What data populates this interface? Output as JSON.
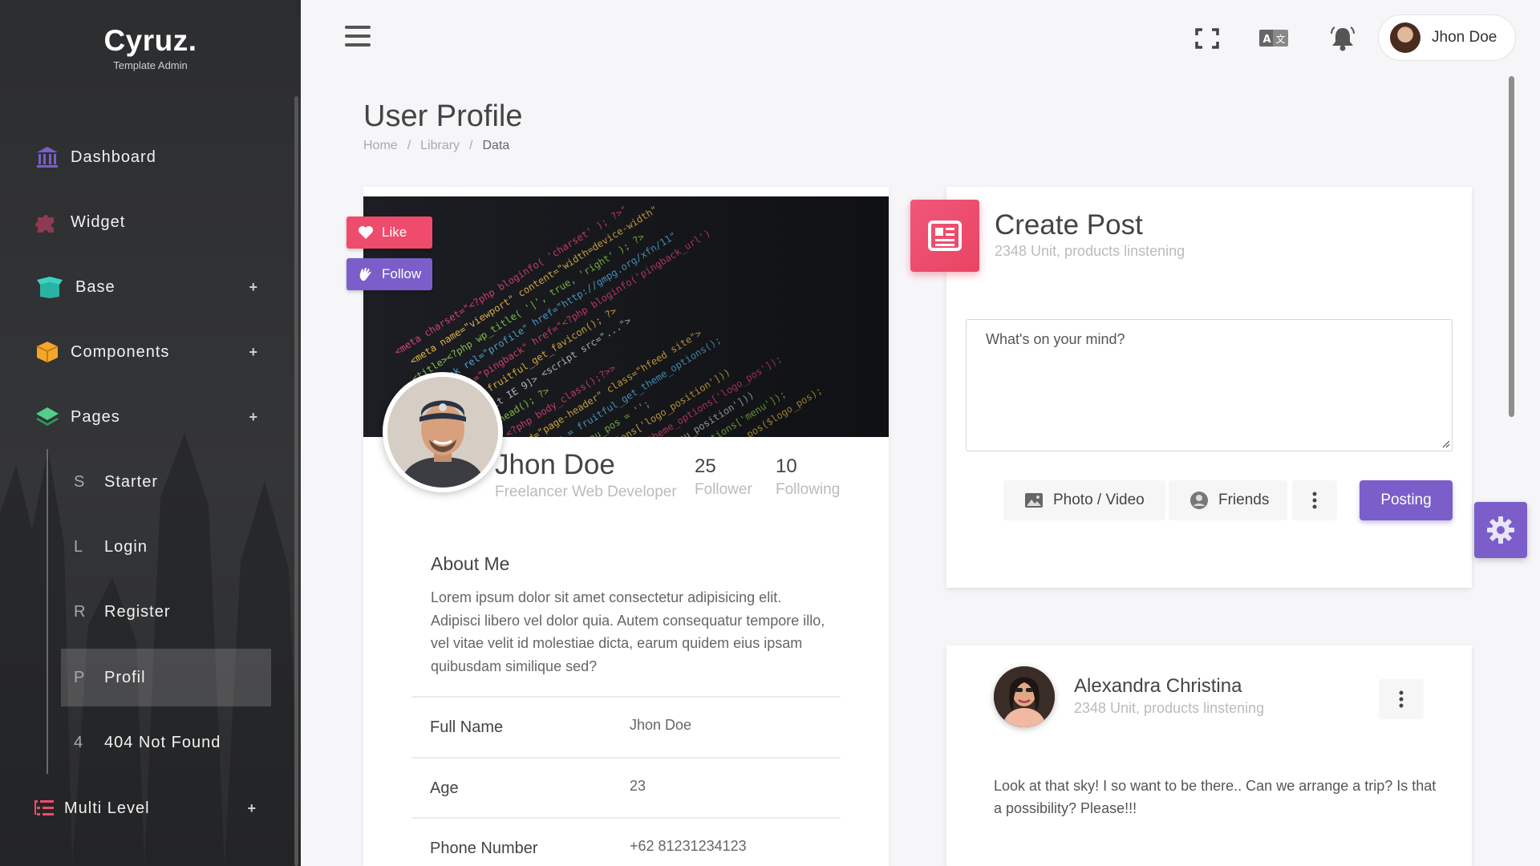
{
  "brand": {
    "name": "Cyruz.",
    "subtitle": "Template Admin"
  },
  "sidebar": {
    "items": [
      {
        "label": "Dashboard",
        "icon": "bank-icon",
        "color": "#7b5ec9"
      },
      {
        "label": "Widget",
        "icon": "puzzle-icon",
        "color": "#8e3a52"
      },
      {
        "label": "Base",
        "icon": "box-open-icon",
        "color": "#2ec4b6",
        "expandable": "+"
      },
      {
        "label": "Components",
        "icon": "cube-icon",
        "color": "#f4a62a",
        "expandable": "+"
      },
      {
        "label": "Pages",
        "icon": "layers-icon",
        "color": "#3bb273",
        "expandable": "+"
      },
      {
        "label": "Multi Level",
        "icon": "list-icon",
        "color": "#ef4b6c",
        "expandable": "+"
      }
    ],
    "pages_submenu": [
      {
        "letter": "S",
        "label": "Starter"
      },
      {
        "letter": "L",
        "label": "Login"
      },
      {
        "letter": "R",
        "label": "Register"
      },
      {
        "letter": "P",
        "label": "Profil",
        "active": true
      },
      {
        "letter": "4",
        "label": "404 Not Found"
      }
    ]
  },
  "topbar": {
    "icons": [
      "menu-icon",
      "fullscreen-icon",
      "translate-icon",
      "bell-icon"
    ],
    "user_name": "Jhon Doe"
  },
  "page": {
    "title": "User Profile",
    "breadcrumb": [
      "Home",
      "/",
      "Library",
      "/",
      "Data"
    ]
  },
  "profile": {
    "like_label": "Like",
    "follow_label": "Follow",
    "name": "Jhon Doe",
    "role": "Freelancer Web Developer",
    "followers": {
      "value": "25",
      "label": "Follower"
    },
    "following": {
      "value": "10",
      "label": "Following"
    },
    "about_title": "About Me",
    "about_text": "Lorem ipsum dolor sit amet consectetur adipisicing elit. Adipisci libero vel dolor quia. Autem consequatur tempore illo, vel vitae velit id molestiae dicta, earum quidem eius ipsam quibusdam similique sed?",
    "info": [
      {
        "key": "Full Name",
        "value": "Jhon Doe"
      },
      {
        "key": "Age",
        "value": "23"
      },
      {
        "key": "Phone Number",
        "value": "+62 81231234123"
      }
    ]
  },
  "create_post": {
    "title": "Create Post",
    "subtitle": "2348 Unit, products linstening",
    "placeholder": "What's on your mind?",
    "photo_label": "Photo / Video",
    "friends_label": "Friends",
    "submit_label": "Posting"
  },
  "feed": {
    "author": "Alexandra Christina",
    "subtitle": "2348 Unit, products linstening",
    "text": "Look at that sky! I so want to be there.. Can we arrange a trip? Is that a possibility? Please!!!"
  },
  "colors": {
    "primary": "#7b5ec9",
    "danger": "#ef4b6c",
    "sidebar_bg": "#2f3032"
  }
}
